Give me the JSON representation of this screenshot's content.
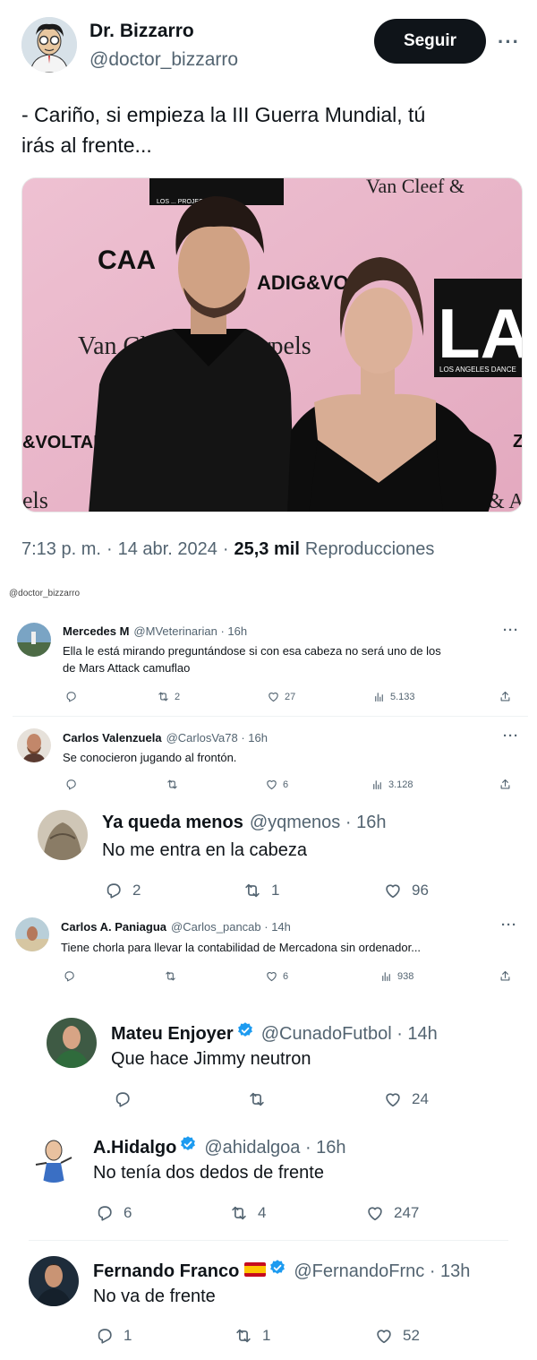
{
  "main_tweet": {
    "name": "Dr. Bizzarro",
    "handle": "@doctor_bizzarro",
    "follow_label": "Seguir",
    "more_label": "···",
    "text_line1": "- Cariño, si empieza la III Guerra Mundial, tú",
    "text_line2": "irás al frente...",
    "media_texts": {
      "top_brand": "Van Cleef &",
      "caa": "CAA",
      "adig": "ADIG&VO",
      "vancleef": "Van Cl",
      "arpels": "Arpels",
      "lad": "LAD",
      "lad_sub": "LOS ANGELES DANCE",
      "voltaire": "&VOLTAIR",
      "els": "els",
      "z": "Z",
      "amp": "f & A",
      "project": "LOS ... PROJECT"
    },
    "time": "7:13 p. m.",
    "date": "14 abr. 2024",
    "views_count": "25,3 mil",
    "views_label": "Reproducciones",
    "sep": "·"
  },
  "watermark": "@doctor_bizzarro",
  "replies": [
    {
      "name": "Mercedes M",
      "handle": "@MVeterinarian · 16h",
      "text1": "Ella le está mirando preguntándose si con esa cabeza no será uno de los",
      "text2": "de Mars Attack camuflao",
      "retweets": "2",
      "likes": "27",
      "views": "5.133",
      "more": "···"
    },
    {
      "name": "Carlos Valenzuela",
      "handle": "@CarlosVa78 · 16h",
      "text1": "Se conocieron jugando al frontón.",
      "retweets": "",
      "likes": "6",
      "views": "3.128",
      "more": "···"
    },
    {
      "name": "Ya queda menos",
      "handle": "@yqmenos · 16h",
      "text1": "No me entra en la cabeza",
      "replies": "2",
      "retweets": "1",
      "likes": "96"
    },
    {
      "name": "Carlos A. Paniagua",
      "handle": "@Carlos_pancab · 14h",
      "text1": "Tiene chorla para llevar la contabilidad de Mercadona sin ordenador...",
      "retweets": "",
      "likes": "6",
      "views": "938",
      "more": "···"
    },
    {
      "name": "Mateu Enjoyer",
      "handle": "@CunadoFutbol · 14h",
      "text1": "Que hace Jimmy neutron",
      "replies": "",
      "retweets": "",
      "likes": "24"
    },
    {
      "name": "A.Hidalgo",
      "handle": "@ahidalgoa · 16h",
      "text1": "No tenía dos dedos de frente",
      "replies": "6",
      "retweets": "4",
      "likes": "247"
    },
    {
      "name": "Fernando Franco",
      "handle": "@FernandoFrnc · 13h",
      "text1": "No va de frente",
      "replies": "1",
      "retweets": "1",
      "likes": "52"
    }
  ],
  "colors": {
    "text": "#0f1419",
    "secondary": "#536471",
    "verified": "#1d9bf0",
    "pink_bg": "#e9b6c8",
    "follow_bg": "#0f1419"
  }
}
